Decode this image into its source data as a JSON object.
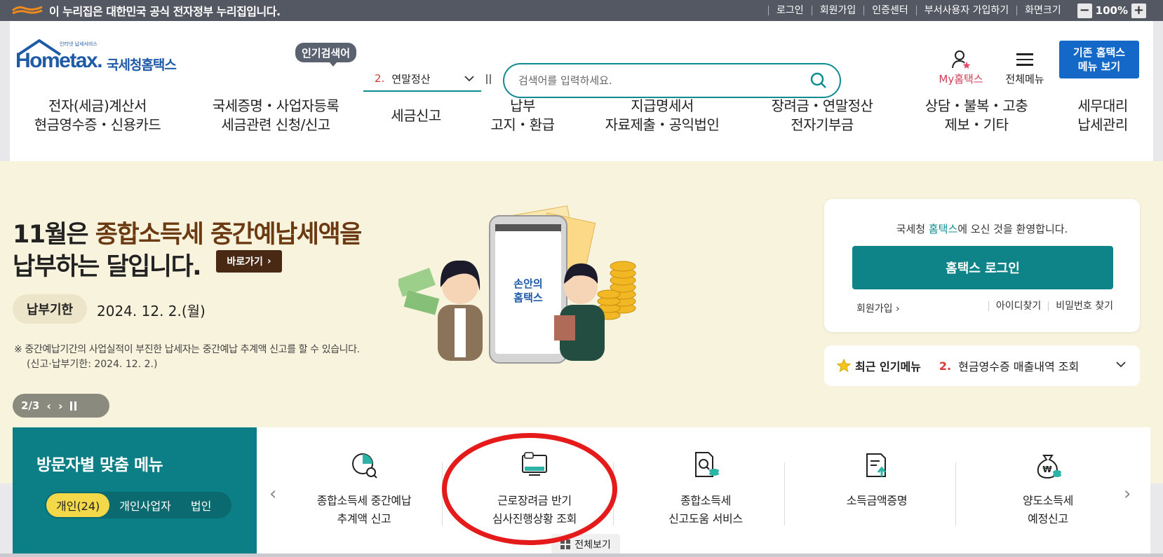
{
  "govbar": {
    "text": "이 누리집은 대한민국 공식 전자정부 누리집입니다.",
    "links": [
      "로그인",
      "회원가입",
      "인증센터",
      "부서사용자 가입하기",
      "화면크기"
    ],
    "zoom": "100%"
  },
  "logo": {
    "small": "인터넷 납세서비스",
    "word": "Hometax.",
    "kr": "국세청홈택스"
  },
  "popular": {
    "badge": "인기검색어",
    "rank": "2.",
    "keyword": "연말정산"
  },
  "search": {
    "placeholder": "검색어를 입력하세요."
  },
  "util": {
    "myhome": "My홈택스",
    "allmenu": "전체메뉴",
    "oldhome_l1": "기존 홈택스",
    "oldhome_l2": "메뉴 보기"
  },
  "gnb": [
    {
      "l1": "전자(세금)계산서",
      "l2": "현금영수증・신용카드"
    },
    {
      "l1": "국세증명・사업자등록",
      "l2": "세금관련 신청/신고"
    },
    {
      "l1": "세금신고",
      "l2": ""
    },
    {
      "l1": "납부",
      "l2": "고지・환급"
    },
    {
      "l1": "지급명세서",
      "l2": "자료제출・공익법인"
    },
    {
      "l1": "장려금・연말정산",
      "l2": "전자기부금"
    },
    {
      "l1": "상담・불복・고충",
      "l2": "제보・기타"
    },
    {
      "l1": "세무대리",
      "l2": "납세관리"
    }
  ],
  "banner": {
    "head1_a": "11월은 ",
    "head1_b": "종합소득세 중간예납세액을",
    "head2": "납부하는 달입니다.",
    "go": "바로가기",
    "due_label": "납부기한",
    "due_date": "2024. 12. 2.(월)",
    "notice1": "※ 중간예납기간의 사업실적이 부진한 납세자는 중간예납 추계액 신고를 할 수 있습니다.",
    "notice2": "(신고·납부기한: 2024. 12. 2.)",
    "phone_l1": "손안의",
    "phone_l2": "홈택스",
    "page": "2/3"
  },
  "login": {
    "welcome_a": "국세청 ",
    "welcome_hl": "홈택스",
    "welcome_b": "에 오신 것을 환영합니다.",
    "button": "홈택스 로그인",
    "join": "회원가입",
    "find_id": "아이디찾기",
    "find_pw": "비밀번호 찾기"
  },
  "recent": {
    "label": "최근 인기메뉴",
    "rank": "2.",
    "value": "현금영수증 매출내역 조회"
  },
  "visitor": {
    "title": "방문자별 맞춤 메뉴",
    "tabs": [
      "개인(24)",
      "개인사업자",
      "법인"
    ]
  },
  "quick": [
    {
      "l1": "종합소득세 중간예납",
      "l2": "추계액 신고",
      "icon": "pie-chart-search-icon"
    },
    {
      "l1": "근로장려금 반기",
      "l2": "심사진행상황 조회",
      "icon": "monitor-chat-icon"
    },
    {
      "l1": "종합소득세",
      "l2": "신고도움 서비스",
      "icon": "document-search-coins-icon"
    },
    {
      "l1": "소득금액증명",
      "l2": "",
      "icon": "document-upload-icon"
    },
    {
      "l1": "양도소득세",
      "l2": "예정신고",
      "icon": "money-bag-icon"
    }
  ],
  "viewall": "전체보기",
  "colors": {
    "teal": "#0c7f86",
    "brand_blue": "#1e5aa8",
    "highlight_red": "#e51a1a",
    "yellow_tab": "#f3d84a"
  }
}
